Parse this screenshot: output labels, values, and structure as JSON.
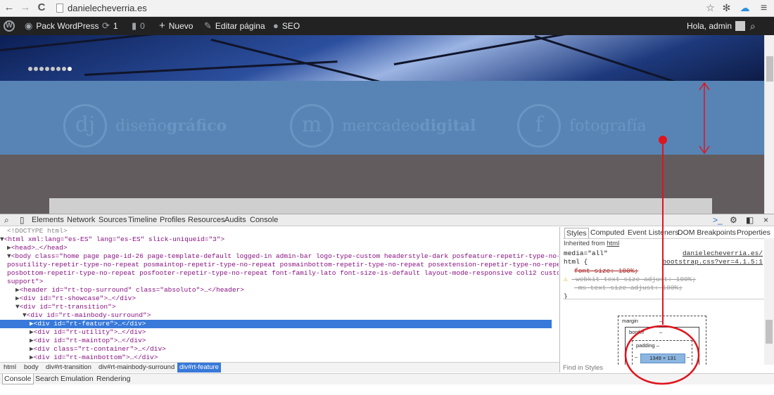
{
  "browser": {
    "url": "danielecheverria.es",
    "back_glyph": "←",
    "forward_glyph": "→",
    "reload_glyph": "C"
  },
  "adminbar": {
    "wp_glyph": "W",
    "site_name": "Pack WordPress",
    "updates_count": "1",
    "comments_count": "0",
    "new_label": "Nuevo",
    "edit_label": "Editar página",
    "seo_label": "SEO",
    "greeting": "Hola, admin"
  },
  "feature": {
    "items": [
      {
        "mono": "dj",
        "plain": "diseño",
        "bold": "gráfico"
      },
      {
        "mono": "m",
        "plain": "mercadeo",
        "bold": "digital"
      },
      {
        "mono": "f",
        "plain": "fotografía",
        "bold": ""
      }
    ],
    "slides": 8,
    "active_slide": 8
  },
  "devtools": {
    "tabs": [
      "Elements",
      "Network",
      "Sources",
      "Timeline",
      "Profiles",
      "Resources",
      "Audits",
      "Console"
    ],
    "active_tab": "Elements",
    "dom_lines": {
      "doctype": "<!DOCTYPE html>",
      "html": "<html xml:lang=\"es-ES\" lang=\"es-ES\" slick-uniqueid=\"3\">",
      "head": "<head>…</head>",
      "body_1": "<body class=\"home page page-id-26 page-template-default logged-in admin-bar logo-type-custom headerstyle-dark posfeature-repetir-type-no-repeat",
      "body_2": "posutility-repetir-type-no-repeat posmaintop-repetir-type-no-repeat posmainbottom-repetir-type-no-repeat posextension-repetir-type-no-repeat",
      "body_3": "posbottom-repetir-type-no-repeat posfooter-repetir-type-no-repeat font-family-lato font-size-is-default layout-mode-responsive col12 customize-",
      "body_4": "support\">",
      "header": "<header id=\"rt-top-surround\" class=\"absoluto\">…</header>",
      "showcase": "<div id=\"rt-showcase\">…</div>",
      "transition": "<div id=\"rt-transition\">",
      "mainbody": "<div id=\"rt-mainbody-surround\">",
      "feature": "<div id=\"rt-feature\">…</div>",
      "utility": "<div id=\"rt-utility\">…</div>",
      "maintop": "<div id=\"rt-maintop\">…</div>",
      "container": "<div class=\"rt-container\">…</div>",
      "mainbottom": "<div id=\"rt-mainbottom\">…</div>"
    },
    "breadcrumbs": [
      "html",
      "body",
      "div#rt-transition",
      "div#rt-mainbody-surround",
      "div#rt-feature"
    ],
    "style_tabs": [
      "Styles",
      "Computed",
      "Event Listeners",
      "DOM Breakpoints",
      "Properties"
    ],
    "styles": {
      "inherited_prefix": "Inherited from ",
      "inherited_from": "html",
      "media": "media=\"all\"",
      "link_1": "danielecheverria.es/",
      "link_2": "bootstrap.css?ver=4.1.5:1",
      "selector": "html {",
      "rule_1": "font-size: 100%;",
      "rule_2": "-webkit-text-size-adjust: 100%;",
      "rule_3": "-ms-text-size-adjust: 100%;",
      "close": "}"
    },
    "box_model": {
      "margin_label": "margin",
      "margin_value": "–",
      "border_label": "border",
      "border_value": "–",
      "padding_label": "padding –",
      "content_size": "1349 × 131",
      "side_dash": "–"
    },
    "find_placeholder": "Find in Styles",
    "drawer_tabs": [
      "Console",
      "Search",
      "Emulation",
      "Rendering"
    ],
    "active_drawer_tab": "Console"
  },
  "colors": {
    "feature_band": "#5784b4",
    "annotation_red": "#e0141e",
    "selection_blue": "#3879d9",
    "admin_bar": "#222222"
  }
}
